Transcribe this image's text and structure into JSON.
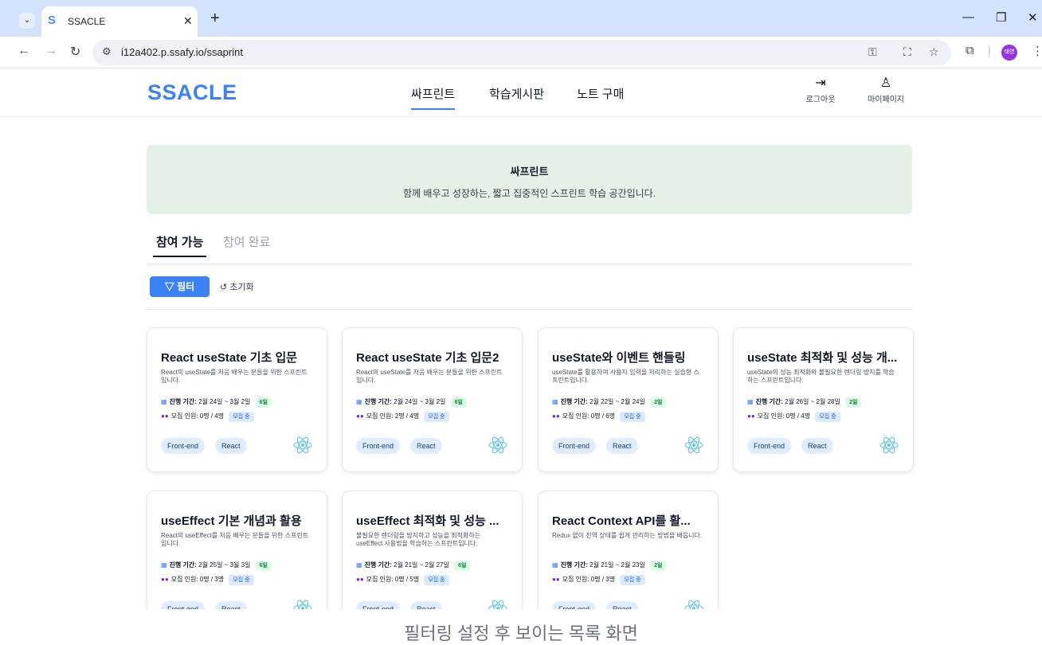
{
  "browser": {
    "tab_title": "SSACLE",
    "tab_favicon": "S",
    "url": "i12a402.p.ssafy.io/ssaprint",
    "profile_initials": "태영"
  },
  "header": {
    "logo": "SSACLE",
    "nav": [
      "싸프린트",
      "학습게시판",
      "노트 구매"
    ],
    "logout_label": "로그아웃",
    "mypage_label": "마이페이지"
  },
  "banner": {
    "title": "싸프린트",
    "subtitle": "함께 배우고 성장하는, 짧고 집중적인 스프린트 학습 공간입니다."
  },
  "list_tabs": [
    "참여 가능",
    "참여 완료"
  ],
  "filter": {
    "filter_label": "필터",
    "reset_label": "초기화"
  },
  "labels": {
    "period": "진행 기간:",
    "members": "모집 인원:"
  },
  "cards": [
    {
      "title": "React useState 기초 입문",
      "desc": "React의 useState를 처음 배우는 분들을 위한 스프린트입니다.",
      "period": "2월 24일 ~ 3월 2일",
      "days": "6일",
      "members": "0명 / 4명",
      "status": "모집 중",
      "tags": [
        "Front-end",
        "React"
      ]
    },
    {
      "title": "React useState 기초 입문2",
      "desc": "React의 useState를 처음 배우는 분들을 위한 스프린트입니다.",
      "period": "2월 24일 ~ 3월 2일",
      "days": "6일",
      "members": "2명 / 4명",
      "status": "모집 중",
      "tags": [
        "Front-end",
        "React"
      ]
    },
    {
      "title": "useState와 이벤트 핸들링",
      "desc": "useState를 활용하여 사용자 입력을 처리하는 실습형 스프린트입니다.",
      "period": "2월 22일 ~ 2월 24일",
      "days": "2일",
      "members": "0명 / 6명",
      "status": "모집 중",
      "tags": [
        "Front-end",
        "React"
      ]
    },
    {
      "title": "useState 최적화 및 성능 개...",
      "desc": "useState의 성능 최적화와 불필요한 렌더링 방지를 학습하는 스프린트입니다.",
      "period": "2월 26일 ~ 2월 28일",
      "days": "2일",
      "members": "0명 / 4명",
      "status": "모집 중",
      "tags": [
        "Front-end",
        "React"
      ]
    },
    {
      "title": "useEffect 기본 개념과 활용",
      "desc": "React의 useEffect를 처음 배우는 분들을 위한 스프린트입니다.",
      "period": "2월 25일 ~ 3월 3일",
      "days": "6일",
      "members": "0명 / 3명",
      "status": "모집 중",
      "tags": [
        "Front-end",
        "React"
      ]
    },
    {
      "title": "useEffect 최적화 및 성능 ...",
      "desc": "불필요한 렌더링을 방지하고 성능을 최적화하는 useEffect 사용법을 학습하는 스프린트입니다.",
      "period": "2월 21일 ~ 2월 27일",
      "days": "6일",
      "members": "0명 / 5명",
      "status": "모집 중",
      "tags": [
        "Front-end",
        "React"
      ]
    },
    {
      "title": "React Context API를 활...",
      "desc": "Redux 없이 전역 상태를 쉽게 관리하는 방법을 배웁니다.",
      "period": "2월 21일 ~ 2월 23일",
      "days": "2일",
      "members": "0명 / 3명",
      "status": "모집 중",
      "tags": [
        "Front-end",
        "React"
      ]
    }
  ],
  "caption": "필터링 설정 후 보이는 목록 화면",
  "colors": {
    "accent": "#3b82f6",
    "banner_bg": "#e3f1e7",
    "days_badge": "#dcfce7",
    "status_badge": "#dbeafe"
  }
}
